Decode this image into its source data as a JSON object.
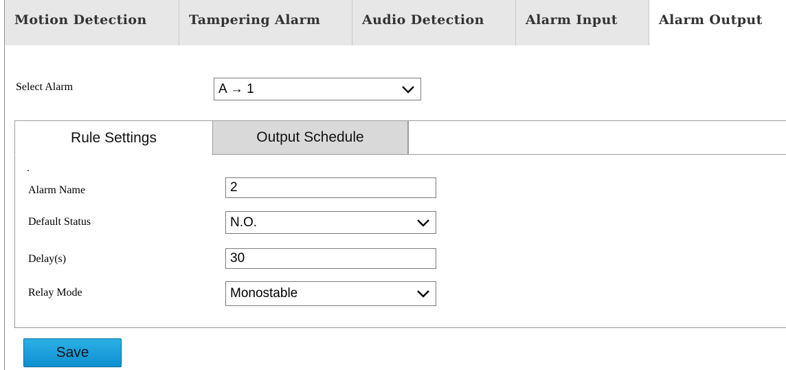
{
  "top_tabs": [
    {
      "label": "Motion Detection"
    },
    {
      "label": "Tampering Alarm"
    },
    {
      "label": "Audio Detection"
    },
    {
      "label": "Alarm Input"
    },
    {
      "label": "Alarm Output"
    }
  ],
  "active_top_tab": "Alarm Output",
  "select_alarm": {
    "label": "Select Alarm",
    "value": "A → 1"
  },
  "inner_tabs": {
    "rule_settings": "Rule Settings",
    "output_schedule": "Output Schedule"
  },
  "form": {
    "alarm_name": {
      "label": "Alarm Name",
      "value": "2"
    },
    "default_status": {
      "label": "Default Status",
      "value": "N.O."
    },
    "delay": {
      "label": "Delay(s)",
      "value": "30"
    },
    "relay_mode": {
      "label": "Relay Mode",
      "value": "Monostable"
    }
  },
  "save_label": "Save",
  "colors": {
    "save_button": "#1aa3dc",
    "tab_inactive": "#e7e7e7",
    "inner_tab_inactive": "#d9d9d9"
  }
}
